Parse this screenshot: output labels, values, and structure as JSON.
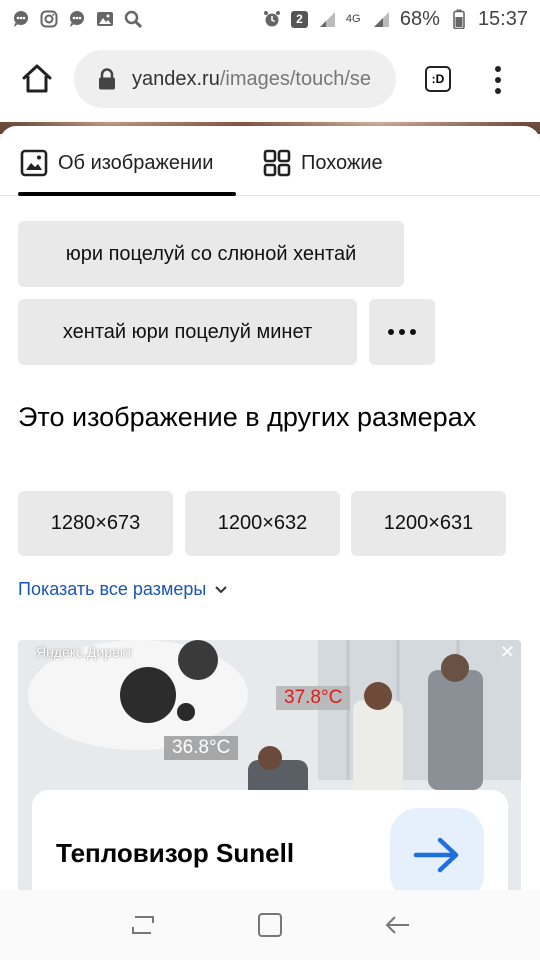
{
  "status_bar": {
    "battery": "68%",
    "time": "15:37",
    "sim_badge": "2",
    "network": "4G",
    "icons_left": [
      "chat-bubble-icon",
      "instagram-icon",
      "chat-bubble-icon",
      "image-icon",
      "search-icon"
    ],
    "icons_right": [
      "alarm-icon",
      "sim-2-icon",
      "signal-icon",
      "signal-icon",
      "battery-icon"
    ]
  },
  "browser": {
    "url_host": "yandex.ru",
    "url_path": "/images/touch/se",
    "tabs_label": ":D"
  },
  "tabs": [
    {
      "label": "Об изображении",
      "icon": "image-icon",
      "active": true
    },
    {
      "label": "Похожие",
      "icon": "grid-icon",
      "active": false
    }
  ],
  "related_queries": [
    "юри поцелуй со слюной хентай",
    "хентай юри поцелуй минет"
  ],
  "sizes_section": {
    "heading": "Это изображение в других размерах",
    "sizes": [
      "1280×673",
      "1200×632",
      "1200×631"
    ],
    "show_all": "Показать все размеры"
  },
  "ad": {
    "label": "Яндекс.Директ",
    "title": "Тепловизор Sunell",
    "temp_hot": "37.8°C",
    "temp_cool": "36.8°C"
  },
  "colors": {
    "link": "#1a55b5",
    "chip_bg": "#e9e9ea",
    "hot_temp": "#e01b1b",
    "arrow": "#1e6fe0"
  }
}
